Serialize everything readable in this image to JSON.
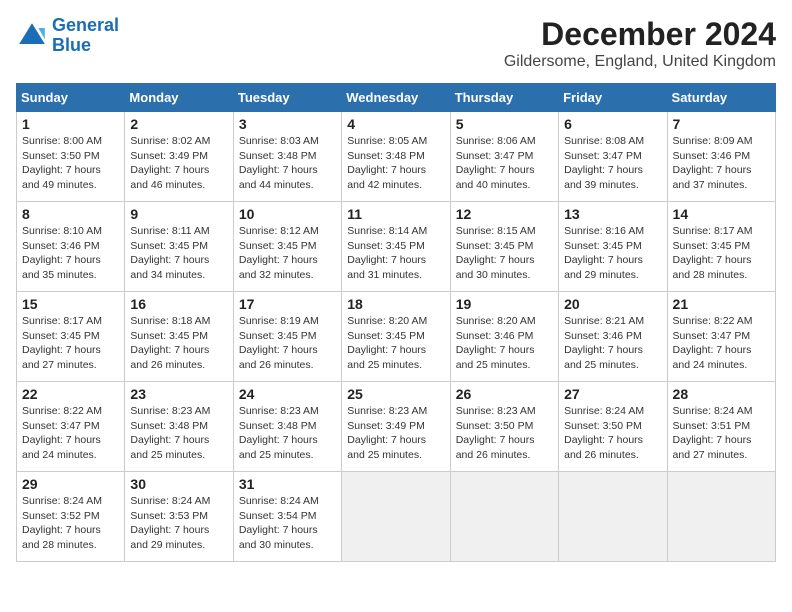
{
  "header": {
    "logo_line1": "General",
    "logo_line2": "Blue",
    "title": "December 2024",
    "subtitle": "Gildersome, England, United Kingdom"
  },
  "calendar": {
    "days_of_week": [
      "Sunday",
      "Monday",
      "Tuesday",
      "Wednesday",
      "Thursday",
      "Friday",
      "Saturday"
    ],
    "weeks": [
      [
        null,
        {
          "day": "2",
          "sunrise": "8:02 AM",
          "sunset": "3:49 PM",
          "daylight": "7 hours and 46 minutes."
        },
        {
          "day": "3",
          "sunrise": "8:03 AM",
          "sunset": "3:48 PM",
          "daylight": "7 hours and 44 minutes."
        },
        {
          "day": "4",
          "sunrise": "8:05 AM",
          "sunset": "3:48 PM",
          "daylight": "7 hours and 42 minutes."
        },
        {
          "day": "5",
          "sunrise": "8:06 AM",
          "sunset": "3:47 PM",
          "daylight": "7 hours and 40 minutes."
        },
        {
          "day": "6",
          "sunrise": "8:08 AM",
          "sunset": "3:47 PM",
          "daylight": "7 hours and 39 minutes."
        },
        {
          "day": "7",
          "sunrise": "8:09 AM",
          "sunset": "3:46 PM",
          "daylight": "7 hours and 37 minutes."
        }
      ],
      [
        {
          "day": "1",
          "sunrise": "8:00 AM",
          "sunset": "3:50 PM",
          "daylight": "7 hours and 49 minutes."
        },
        {
          "day": "8",
          "sunrise": "8:10 AM",
          "sunset": "3:46 PM",
          "daylight": "7 hours and 35 minutes."
        },
        {
          "day": "9",
          "sunrise": "8:11 AM",
          "sunset": "3:45 PM",
          "daylight": "7 hours and 34 minutes."
        },
        {
          "day": "10",
          "sunrise": "8:12 AM",
          "sunset": "3:45 PM",
          "daylight": "7 hours and 32 minutes."
        },
        {
          "day": "11",
          "sunrise": "8:14 AM",
          "sunset": "3:45 PM",
          "daylight": "7 hours and 31 minutes."
        },
        {
          "day": "12",
          "sunrise": "8:15 AM",
          "sunset": "3:45 PM",
          "daylight": "7 hours and 30 minutes."
        },
        {
          "day": "13",
          "sunrise": "8:16 AM",
          "sunset": "3:45 PM",
          "daylight": "7 hours and 29 minutes."
        },
        {
          "day": "14",
          "sunrise": "8:17 AM",
          "sunset": "3:45 PM",
          "daylight": "7 hours and 28 minutes."
        }
      ],
      [
        {
          "day": "15",
          "sunrise": "8:17 AM",
          "sunset": "3:45 PM",
          "daylight": "7 hours and 27 minutes."
        },
        {
          "day": "16",
          "sunrise": "8:18 AM",
          "sunset": "3:45 PM",
          "daylight": "7 hours and 26 minutes."
        },
        {
          "day": "17",
          "sunrise": "8:19 AM",
          "sunset": "3:45 PM",
          "daylight": "7 hours and 26 minutes."
        },
        {
          "day": "18",
          "sunrise": "8:20 AM",
          "sunset": "3:45 PM",
          "daylight": "7 hours and 25 minutes."
        },
        {
          "day": "19",
          "sunrise": "8:20 AM",
          "sunset": "3:46 PM",
          "daylight": "7 hours and 25 minutes."
        },
        {
          "day": "20",
          "sunrise": "8:21 AM",
          "sunset": "3:46 PM",
          "daylight": "7 hours and 25 minutes."
        },
        {
          "day": "21",
          "sunrise": "8:22 AM",
          "sunset": "3:47 PM",
          "daylight": "7 hours and 24 minutes."
        }
      ],
      [
        {
          "day": "22",
          "sunrise": "8:22 AM",
          "sunset": "3:47 PM",
          "daylight": "7 hours and 24 minutes."
        },
        {
          "day": "23",
          "sunrise": "8:23 AM",
          "sunset": "3:48 PM",
          "daylight": "7 hours and 25 minutes."
        },
        {
          "day": "24",
          "sunrise": "8:23 AM",
          "sunset": "3:48 PM",
          "daylight": "7 hours and 25 minutes."
        },
        {
          "day": "25",
          "sunrise": "8:23 AM",
          "sunset": "3:49 PM",
          "daylight": "7 hours and 25 minutes."
        },
        {
          "day": "26",
          "sunrise": "8:23 AM",
          "sunset": "3:50 PM",
          "daylight": "7 hours and 26 minutes."
        },
        {
          "day": "27",
          "sunrise": "8:24 AM",
          "sunset": "3:50 PM",
          "daylight": "7 hours and 26 minutes."
        },
        {
          "day": "28",
          "sunrise": "8:24 AM",
          "sunset": "3:51 PM",
          "daylight": "7 hours and 27 minutes."
        }
      ],
      [
        {
          "day": "29",
          "sunrise": "8:24 AM",
          "sunset": "3:52 PM",
          "daylight": "7 hours and 28 minutes."
        },
        {
          "day": "30",
          "sunrise": "8:24 AM",
          "sunset": "3:53 PM",
          "daylight": "7 hours and 29 minutes."
        },
        {
          "day": "31",
          "sunrise": "8:24 AM",
          "sunset": "3:54 PM",
          "daylight": "7 hours and 30 minutes."
        },
        null,
        null,
        null,
        null
      ]
    ]
  }
}
